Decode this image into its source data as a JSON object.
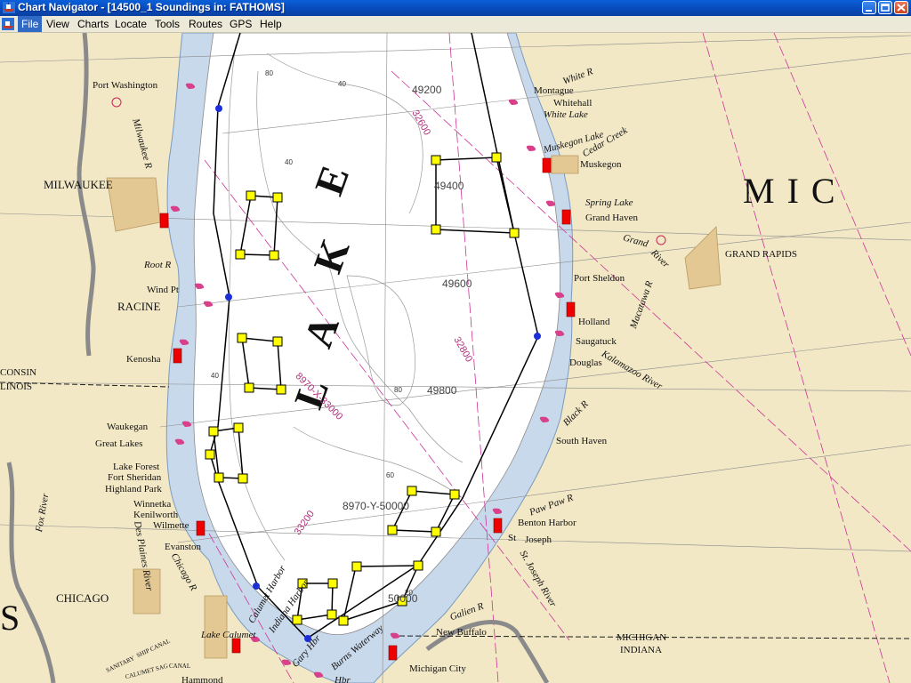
{
  "window": {
    "title": "Chart Navigator - [14500_1 Soundings in: FATHOMS]"
  },
  "menu": {
    "items": [
      "File",
      "View",
      "Charts",
      "Locate",
      "Tools",
      "Routes",
      "GPS",
      "Help"
    ],
    "active": "File"
  },
  "map": {
    "colors": {
      "land": "#f2e8c6",
      "water_shallow": "#c9d9ec",
      "water_deep": "#ffffff",
      "route": "#000000",
      "waypoint": "#ffff00",
      "marker": "#ff0000",
      "loran_line": "#cc3399",
      "border_line": "#1a1a1a"
    },
    "labels": {
      "lake_l": "L",
      "lake_a": "A",
      "lake_k": "K",
      "lake_e": "E",
      "mic": "M I C",
      "port_washington": "Port Washington",
      "milwaukee_r": "Milwaukee R",
      "milwaukee": "MILWAUKEE",
      "root_r": "Root R",
      "wind_pt": "Wind Pt",
      "racine": "RACINE",
      "kenosha": "Kenosha",
      "wisconsin": "CONSIN",
      "illinois": "LINOIS",
      "waukegan": "Waukegan",
      "great_lakes": "Great Lakes",
      "lake_forest": "Lake Forest",
      "fort_sheridan": "Fort Sheridan",
      "highland_park": "Highland Park",
      "winnetka": "Winnetka",
      "kenilworth": "Kenilworth",
      "wilmette": "Wilmette",
      "evanston": "Evanston",
      "des_plaines_river": "Des Plaines River",
      "fox_river": "Fox River",
      "chicago_r": "Chicago R",
      "chicago": "CHICAGO",
      "lake_calumet": "Lake Calumet",
      "calumet_harbor": "Calumet Harbor",
      "indiana_harbor": "Indiana Harbor",
      "gary_hbr": "Gary Hbr",
      "burns_waterway": "Burns Waterway",
      "hbr": "Hbr",
      "sanitary": "SANITARY",
      "ship_canal": "SHIP CANAL",
      "calumet_sag": "CALUMET SAG",
      "canal": "CANAL",
      "hammond": "Hammond",
      "white_r": "White R",
      "montague": "Montague",
      "whitehall": "Whitehall",
      "white_lake": "White Lake",
      "muskegon_lake": "Muskegon Lake",
      "cedar_creek": "Cedar Creek",
      "muskegon": "Muskegon",
      "spring_lake": "Spring Lake",
      "grand_haven": "Grand Haven",
      "grand_river": "Grand",
      "river": "River",
      "grand_rapids": "GRAND RAPIDS",
      "port_sheldon": "Port Sheldon",
      "macatawa_r": "Macatawa R",
      "holland": "Holland",
      "saugatuck": "Saugatuck",
      "douglas": "Douglas",
      "kalamazoo_river": "Kalamazoo River",
      "black_r": "Black R",
      "south_haven": "South Haven",
      "paw_paw_r": "Paw Paw R",
      "benton_harbor": "Benton Harbor",
      "st": "St",
      "st_joseph": "Joseph",
      "st_joseph_river": "St. Joseph River",
      "galien_r": "Galien R",
      "new_buffalo": "New Buffalo",
      "michigan_city": "Michigan City",
      "michigan": "MICHIGAN",
      "indiana": "INDIANA",
      "s": "S",
      "loran_32600": "32600",
      "loran_32800": "32800",
      "loran_33200": "33200",
      "loran_x": "8970-X-33000",
      "loran_y": "8970-Y-50000",
      "depth_49200": "49200",
      "depth_49400": "49400",
      "depth_49600": "49600",
      "depth_49800": "49800",
      "depth_50000": "50000",
      "c40a": "40",
      "c40b": "40",
      "c40c": "40",
      "c60": "60",
      "c80a": "80",
      "c80b": "80",
      "c20": "20"
    }
  }
}
